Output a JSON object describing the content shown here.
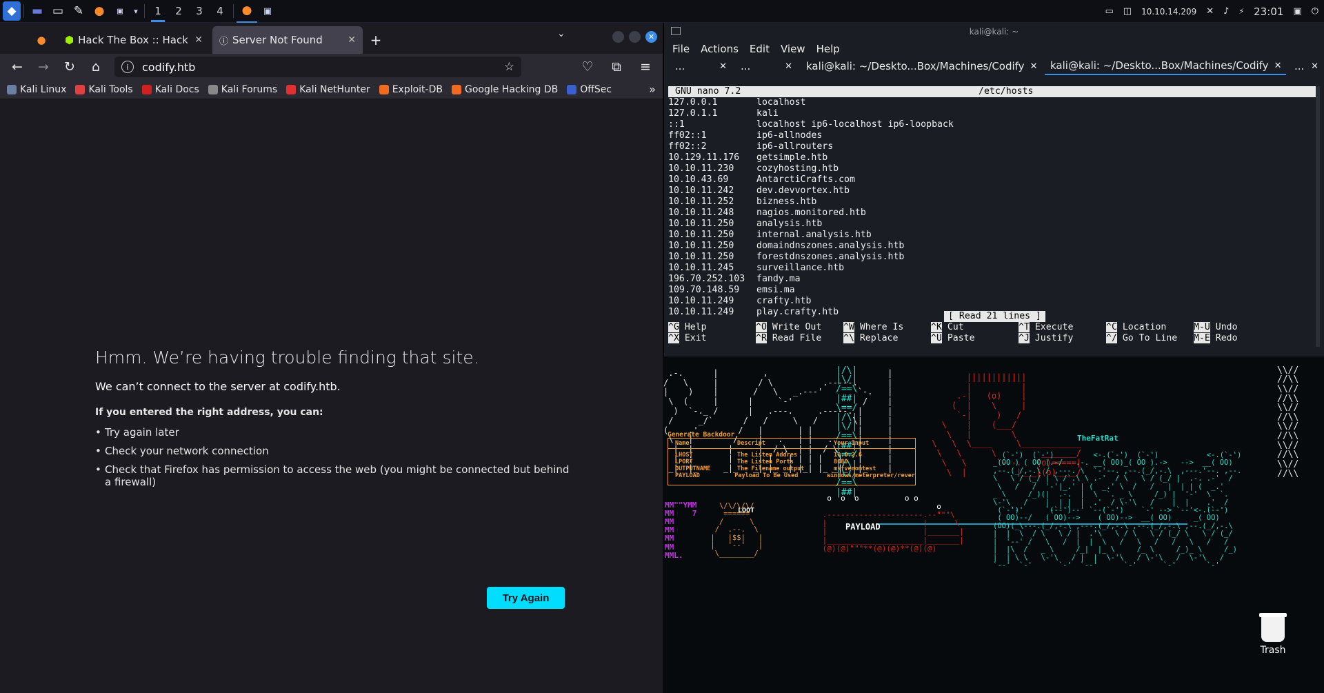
{
  "topbar": {
    "workspaces": [
      "1",
      "2",
      "3",
      "4"
    ],
    "active_workspace": "1",
    "ip": "10.10.14.209",
    "clock": "23:01"
  },
  "firefox": {
    "tabs": [
      {
        "label": "Hack The Box :: Hack The B"
      },
      {
        "label": "Server Not Found"
      }
    ],
    "url": "codify.htb",
    "bookmarks": [
      "Kali Linux",
      "Kali Tools",
      "Kali Docs",
      "Kali Forums",
      "Kali NetHunter",
      "Exploit-DB",
      "Google Hacking DB",
      "OffSec"
    ],
    "error": {
      "title": "Hmm. We’re having trouble finding that site.",
      "lead": "We can’t connect to the server at codify.htb.",
      "sub": "If you entered the right address, you can:",
      "items": [
        "Try again later",
        "Check your network connection",
        "Check that Firefox has permission to access the web (you might be connected but behind a firewall)"
      ],
      "button": "Try Again"
    }
  },
  "terminal": {
    "title": "kali@kali: ~",
    "menu": [
      "File",
      "Actions",
      "Edit",
      "View",
      "Help"
    ],
    "tabs": [
      "...",
      "...",
      "kali@kali: ~/Deskto...Box/Machines/Codify",
      "kali@kali: ~/Deskto...Box/Machines/Codify",
      "..."
    ],
    "nano": {
      "version": "GNU nano 7.2",
      "file": "/etc/hosts",
      "lines": [
        [
          "127.0.0.1",
          "localhost"
        ],
        [
          "127.0.1.1",
          "kali"
        ],
        [
          "::1",
          "localhost ip6-localhost ip6-loopback"
        ],
        [
          "ff02::1",
          "ip6-allnodes"
        ],
        [
          "ff02::2",
          "ip6-allrouters"
        ],
        [
          "10.129.11.176",
          "getsimple.htb"
        ],
        [
          "10.10.11.230",
          "cozyhosting.htb"
        ],
        [
          "10.10.43.69",
          "AntarctiCrafts.com"
        ],
        [
          "10.10.11.242",
          "dev.devvortex.htb"
        ],
        [
          "10.10.11.252",
          "bizness.htb"
        ],
        [
          "10.10.11.248",
          "nagios.monitored.htb"
        ],
        [
          "10.10.11.250",
          "analysis.htb"
        ],
        [
          "10.10.11.250",
          "internal.analysis.htb"
        ],
        [
          "10.10.11.250",
          "domaindnszones.analysis.htb"
        ],
        [
          "10.10.11.250",
          "forestdnszones.analysis.htb"
        ],
        [
          "10.10.11.245",
          "surveillance.htb"
        ],
        [
          "196.70.252.103",
          "fandy.ma"
        ],
        [
          "109.70.148.59",
          "emsi.ma"
        ],
        [
          "10.10.11.249",
          "crafty.htb"
        ],
        [
          "10.10.11.249",
          "play.crafty.htb"
        ]
      ],
      "status": "[ Read 21 lines ]",
      "keys_row1": [
        [
          "^G",
          "Help"
        ],
        [
          "^O",
          "Write Out"
        ],
        [
          "^W",
          "Where Is"
        ],
        [
          "^K",
          "Cut"
        ],
        [
          "^T",
          "Execute"
        ],
        [
          "^C",
          "Location"
        ],
        [
          "M-U",
          "Undo"
        ]
      ],
      "keys_row2": [
        [
          "^X",
          "Exit"
        ],
        [
          "^R",
          "Read File"
        ],
        [
          "^\\",
          "Replace"
        ],
        [
          "^U",
          "Paste"
        ],
        [
          "^J",
          "Justify"
        ],
        [
          "^/",
          "Go To Line"
        ],
        [
          "M-E",
          "Redo"
        ]
      ]
    }
  },
  "desktop": {
    "fatrat_label": "TheFatRat",
    "backdoor_title": "Generate Backdoor",
    "backdoor_headers": [
      "Name",
      "Descript",
      "Your Input"
    ],
    "backdoor_rows": [
      [
        "LHOST",
        "The Listen Addres",
        "10.0.2.6"
      ],
      [
        "LPORT",
        "The Listen Ports",
        "8080"
      ],
      [
        "OUTPUTNAME",
        "The Filename output",
        "msfvenomtest"
      ],
      [
        "PAYLOAD",
        "Payload To Be Used",
        "windows/meterpreter/rever"
      ]
    ],
    "loot_label": "LOOT",
    "payload_label": "PAYLOAD",
    "trash_label": "Trash",
    "colors": {
      "red": "#e0251b",
      "orange": "#f0a030",
      "cyan": "#20e0d0",
      "purple": "#c030e0",
      "white": "#e8e8e8"
    }
  }
}
